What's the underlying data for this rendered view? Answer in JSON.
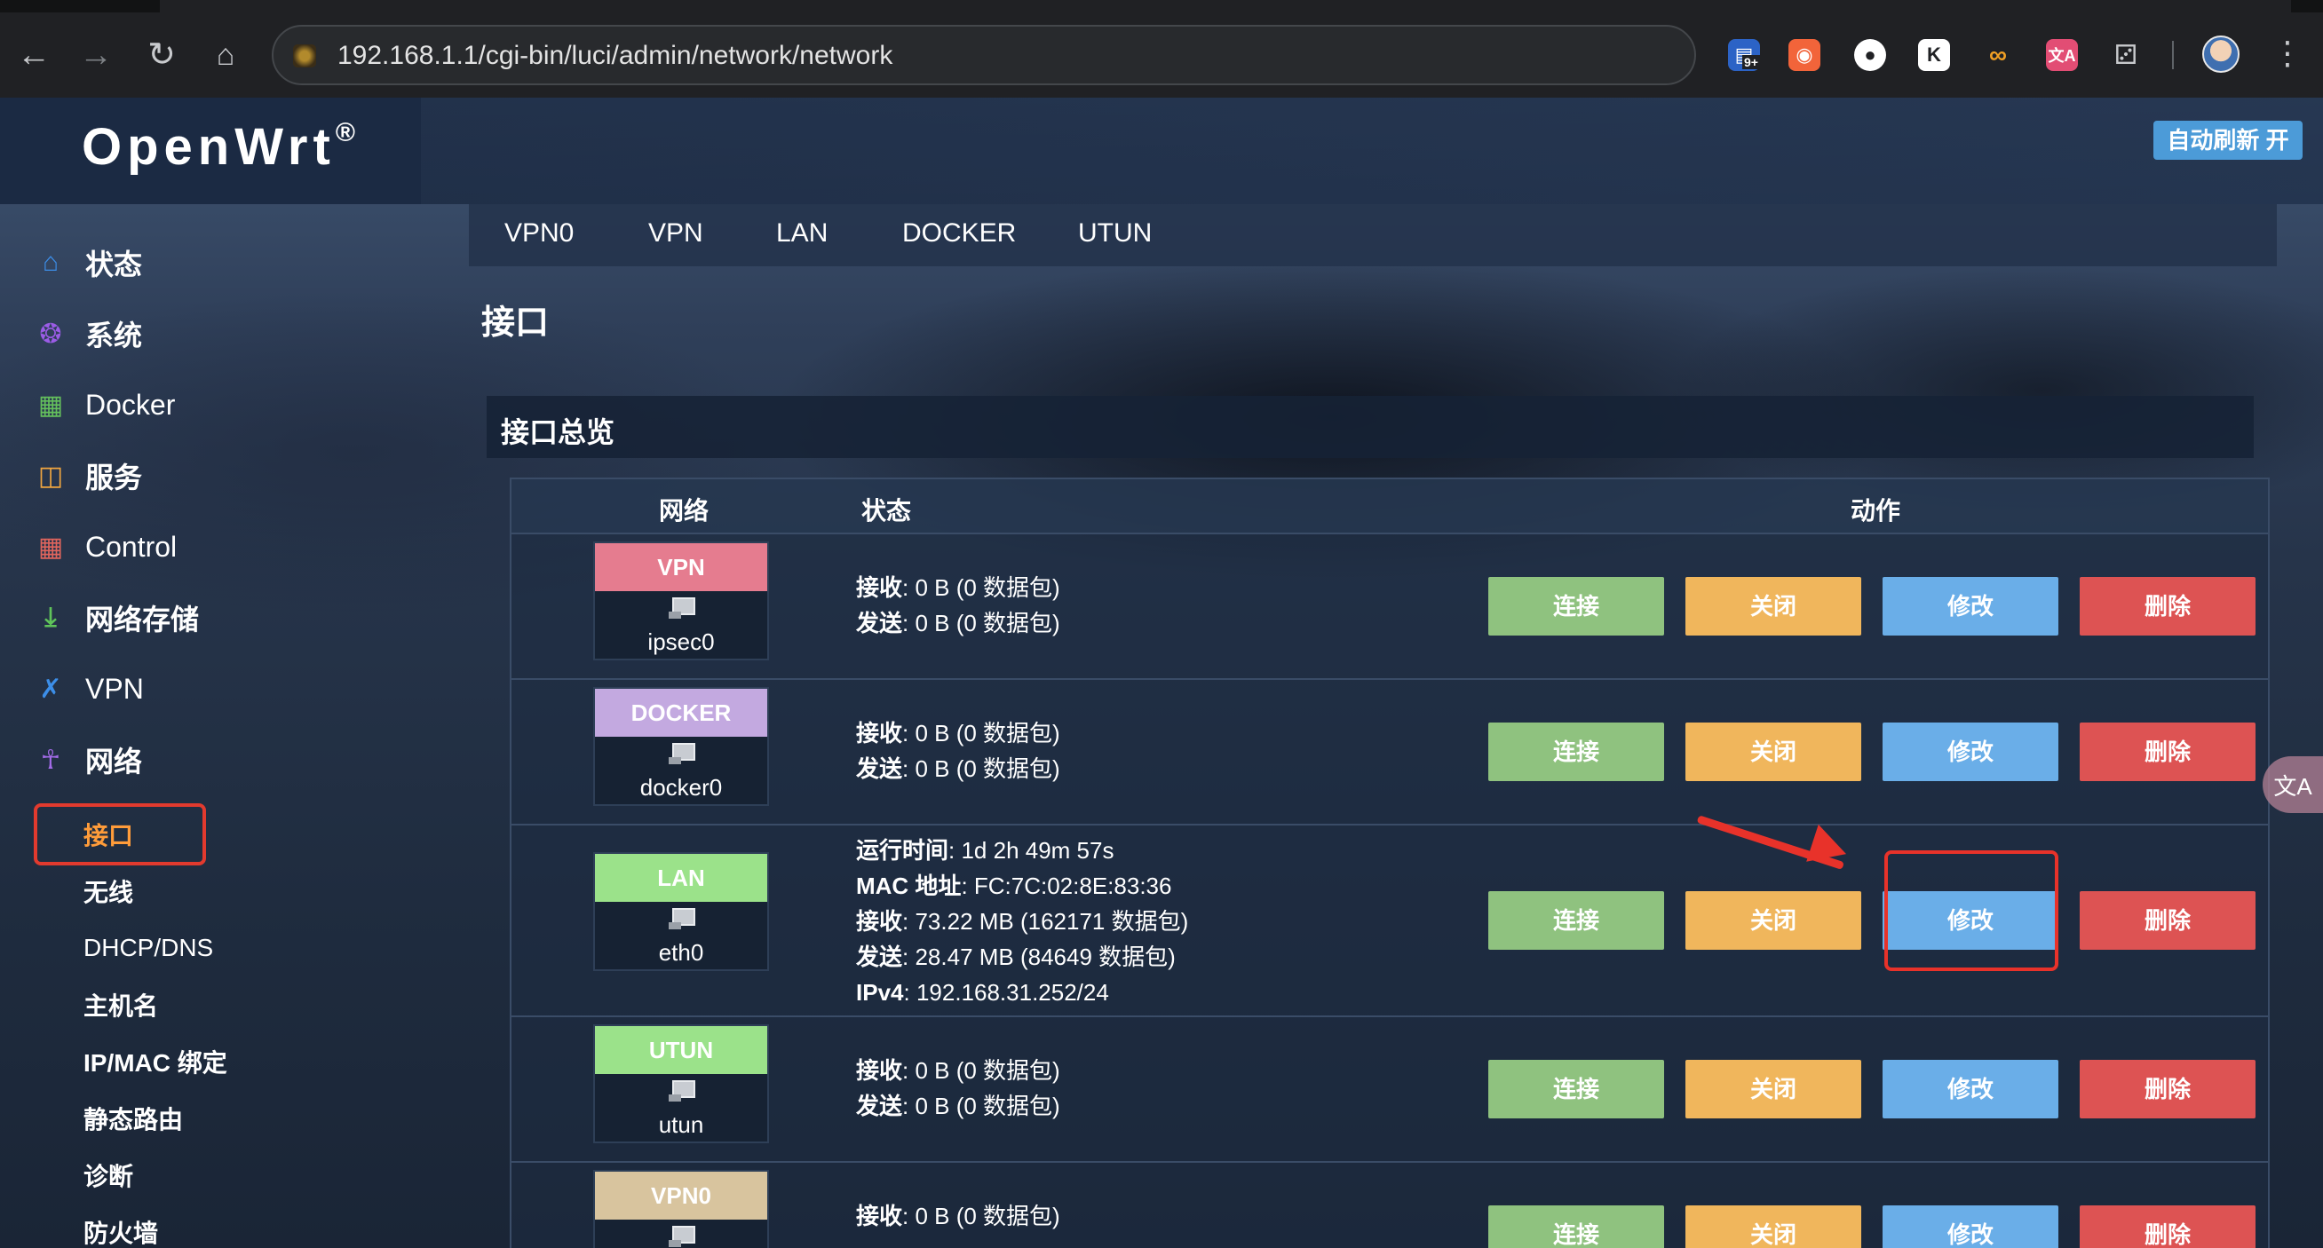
{
  "browser": {
    "url": "192.168.1.1/cgi-bin/luci/admin/network/network",
    "extension_badge": "9+"
  },
  "header": {
    "brand": "OpenWrt",
    "brand_mark": "®",
    "auto_refresh": "自动刷新 开"
  },
  "sidebar": {
    "items": [
      {
        "label": "状态",
        "icon": "home-icon"
      },
      {
        "label": "系统",
        "icon": "gear-icon"
      },
      {
        "label": "Docker",
        "icon": "grid-icon"
      },
      {
        "label": "服务",
        "icon": "services-icon"
      },
      {
        "label": "Control",
        "icon": "calendar-icon"
      },
      {
        "label": "网络存储",
        "icon": "download-icon"
      },
      {
        "label": "VPN",
        "icon": "vpn-icon"
      },
      {
        "label": "网络",
        "icon": "network-icon"
      }
    ],
    "network_sub": [
      "接口",
      "无线",
      "DHCP/DNS",
      "主机名",
      "IP/MAC 绑定",
      "静态路由",
      "诊断",
      "防火墙"
    ]
  },
  "tabs": [
    "VPN0",
    "VPN",
    "LAN",
    "DOCKER",
    "UTUN"
  ],
  "page_title": "接口",
  "section_title": "接口总览",
  "table": {
    "headers": {
      "network": "网络",
      "status": "状态",
      "actions": "动作"
    },
    "actions": {
      "connect": "连接",
      "stop": "关闭",
      "edit": "修改",
      "delete": "删除"
    },
    "rows": [
      {
        "name": "VPN",
        "device": "ipsec0",
        "color": "#e57c8f",
        "status": [
          {
            "k": "接收",
            "v": ": 0 B (0 数据包)"
          },
          {
            "k": "发送",
            "v": ": 0 B (0 数据包)"
          }
        ]
      },
      {
        "name": "DOCKER",
        "device": "docker0",
        "color": "#c3a9e0",
        "status": [
          {
            "k": "接收",
            "v": ": 0 B (0 数据包)"
          },
          {
            "k": "发送",
            "v": ": 0 B (0 数据包)"
          }
        ]
      },
      {
        "name": "LAN",
        "device": "eth0",
        "color": "#9be28a",
        "status": [
          {
            "k": "运行时间",
            "v": ": 1d 2h 49m 57s"
          },
          {
            "k": "MAC 地址",
            "v": ": FC:7C:02:8E:83:36"
          },
          {
            "k": "接收",
            "v": ": 73.22 MB (162171 数据包)"
          },
          {
            "k": "发送",
            "v": ": 28.47 MB (84649 数据包)"
          },
          {
            "k": "IPv4",
            "v": ": 192.168.31.252/24"
          }
        ]
      },
      {
        "name": "UTUN",
        "device": "utun",
        "color": "#9be28a",
        "status": [
          {
            "k": "接收",
            "v": ": 0 B (0 数据包)"
          },
          {
            "k": "发送",
            "v": ": 0 B (0 数据包)"
          }
        ]
      },
      {
        "name": "VPN0",
        "device": "",
        "color": "#d8c49e",
        "status": [
          {
            "k": "接收",
            "v": ": 0 B (0 数据包)"
          }
        ]
      }
    ]
  }
}
